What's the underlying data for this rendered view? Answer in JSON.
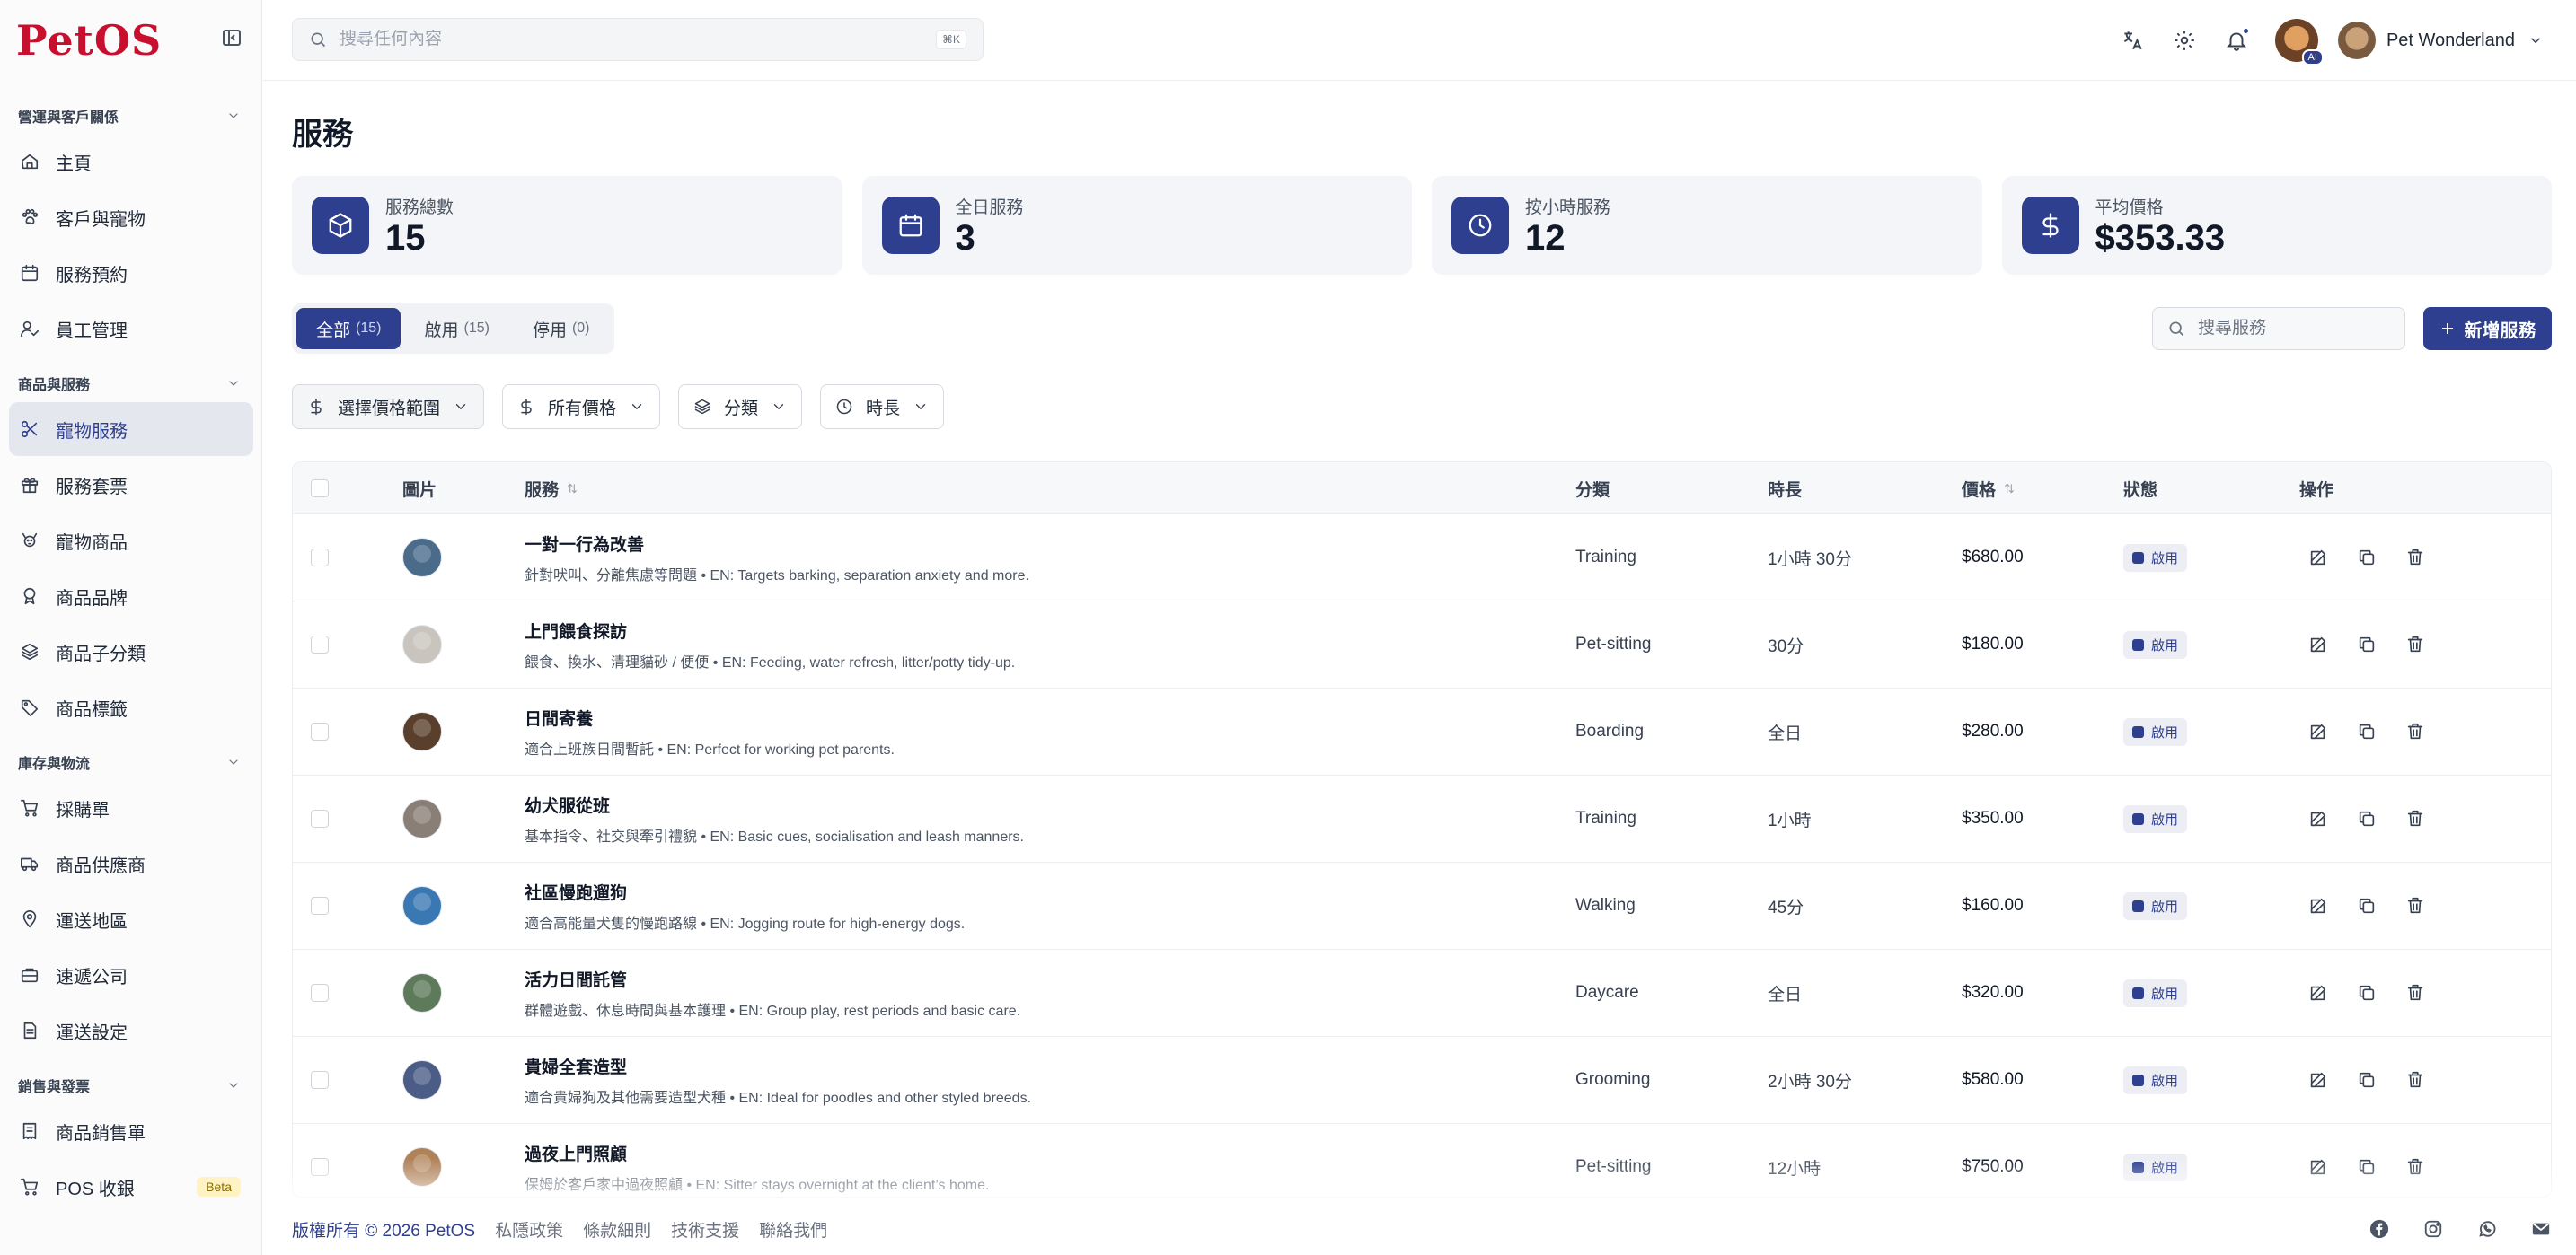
{
  "brand": {
    "logo": "PetOS",
    "accent": "#2e3f8f",
    "logo_color": "#c8102e"
  },
  "sidebar": {
    "groups": [
      {
        "label": "營運與客戶關係",
        "items": [
          {
            "label": "主頁",
            "icon": "home-icon"
          },
          {
            "label": "客戶與寵物",
            "icon": "paw-icon"
          },
          {
            "label": "服務預約",
            "icon": "calendar-icon"
          },
          {
            "label": "員工管理",
            "icon": "user-check-icon"
          }
        ]
      },
      {
        "label": "商品與服務",
        "items": [
          {
            "label": "寵物服務",
            "icon": "scissors-icon",
            "active": true
          },
          {
            "label": "服務套票",
            "icon": "gift-icon"
          },
          {
            "label": "寵物商品",
            "icon": "dog-icon"
          },
          {
            "label": "商品品牌",
            "icon": "award-icon"
          },
          {
            "label": "商品子分類",
            "icon": "layers-icon"
          },
          {
            "label": "商品標籤",
            "icon": "tag-icon"
          }
        ]
      },
      {
        "label": "庫存與物流",
        "items": [
          {
            "label": "採購單",
            "icon": "cart-icon"
          },
          {
            "label": "商品供應商",
            "icon": "truck-icon"
          },
          {
            "label": "運送地區",
            "icon": "map-pin-icon"
          },
          {
            "label": "速遞公司",
            "icon": "briefcase-icon"
          },
          {
            "label": "運送設定",
            "icon": "document-icon"
          }
        ]
      },
      {
        "label": "銷售與發票",
        "items": [
          {
            "label": "商品銷售單",
            "icon": "receipt-icon"
          },
          {
            "label": "POS 收銀",
            "icon": "cart-icon",
            "badge": "Beta"
          }
        ]
      }
    ]
  },
  "topbar": {
    "search_placeholder": "搜尋任何內容",
    "shortcut": "⌘K",
    "ai_badge": "AI",
    "user_name": "Pet Wonderland"
  },
  "page": {
    "title": "服務"
  },
  "stats": [
    {
      "label": "服務總數",
      "value": "15",
      "icon": "box-icon"
    },
    {
      "label": "全日服務",
      "value": "3",
      "icon": "calendar-icon"
    },
    {
      "label": "按小時服務",
      "value": "12",
      "icon": "clock-icon"
    },
    {
      "label": "平均價格",
      "value": "$353.33",
      "icon": "dollar-icon"
    }
  ],
  "tabs": [
    {
      "label": "全部",
      "count": "(15)",
      "active": true
    },
    {
      "label": "啟用",
      "count": "(15)"
    },
    {
      "label": "停用",
      "count": "(0)"
    }
  ],
  "search_service_placeholder": "搜尋服務",
  "add_button": "新增服務",
  "filters": [
    {
      "label": "選擇價格範圍",
      "icon": "dollar-icon"
    },
    {
      "label": "所有價格",
      "icon": "dollar-icon"
    },
    {
      "label": "分類",
      "icon": "layers-icon"
    },
    {
      "label": "時長",
      "icon": "clock-icon"
    }
  ],
  "table": {
    "headers": {
      "image": "圖片",
      "service": "服務",
      "category": "分類",
      "duration": "時長",
      "price": "價格",
      "status": "狀態",
      "actions": "操作"
    },
    "rows": [
      {
        "name": "一對一行為改善",
        "desc": "針對吠叫、分離焦慮等問題 • EN: Targets barking, separation anxiety and more.",
        "category": "Training",
        "duration": "1小時 30分",
        "price": "$680.00",
        "status": "啟用",
        "thumb": "#4a6b8a"
      },
      {
        "name": "上門餵食探訪",
        "desc": "餵食、換水、清理貓砂 / 便便 • EN: Feeding, water refresh, litter/potty tidy-up.",
        "category": "Pet-sitting",
        "duration": "30分",
        "price": "$180.00",
        "status": "啟用",
        "thumb": "#c9c4bd"
      },
      {
        "name": "日間寄養",
        "desc": "適合上班族日間暫託 • EN: Perfect for working pet parents.",
        "category": "Boarding",
        "duration": "全日",
        "price": "$280.00",
        "status": "啟用",
        "thumb": "#5a3f2c"
      },
      {
        "name": "幼犬服從班",
        "desc": "基本指令、社交與牽引禮貌 • EN: Basic cues, socialisation and leash manners.",
        "category": "Training",
        "duration": "1小時",
        "price": "$350.00",
        "status": "啟用",
        "thumb": "#8a7f76"
      },
      {
        "name": "社區慢跑遛狗",
        "desc": "適合高能量犬隻的慢跑路線 • EN: Jogging route for high-energy dogs.",
        "category": "Walking",
        "duration": "45分",
        "price": "$160.00",
        "status": "啟用",
        "thumb": "#3a78b4"
      },
      {
        "name": "活力日間託管",
        "desc": "群體遊戲、休息時間與基本護理 • EN: Group play, rest periods and basic care.",
        "category": "Daycare",
        "duration": "全日",
        "price": "$320.00",
        "status": "啟用",
        "thumb": "#5d7a5a"
      },
      {
        "name": "貴婦全套造型",
        "desc": "適合貴婦狗及其他需要造型犬種 • EN: Ideal for poodles and other styled breeds.",
        "category": "Grooming",
        "duration": "2小時 30分",
        "price": "$580.00",
        "status": "啟用",
        "thumb": "#4b5d86"
      },
      {
        "name": "過夜上門照顧",
        "desc": "保姆於客戶家中過夜照顧 • EN: Sitter stays overnight at the client’s home.",
        "category": "Pet-sitting",
        "duration": "12小時",
        "price": "$750.00",
        "status": "啟用",
        "thumb": "#b08258"
      }
    ]
  },
  "footer": {
    "copyright": "版權所有 © 2026 PetOS",
    "links": [
      "私隱政策",
      "條款細則",
      "技術支援",
      "聯絡我們"
    ],
    "social": [
      "facebook-icon",
      "instagram-icon",
      "whatsapp-icon",
      "mail-icon"
    ]
  }
}
